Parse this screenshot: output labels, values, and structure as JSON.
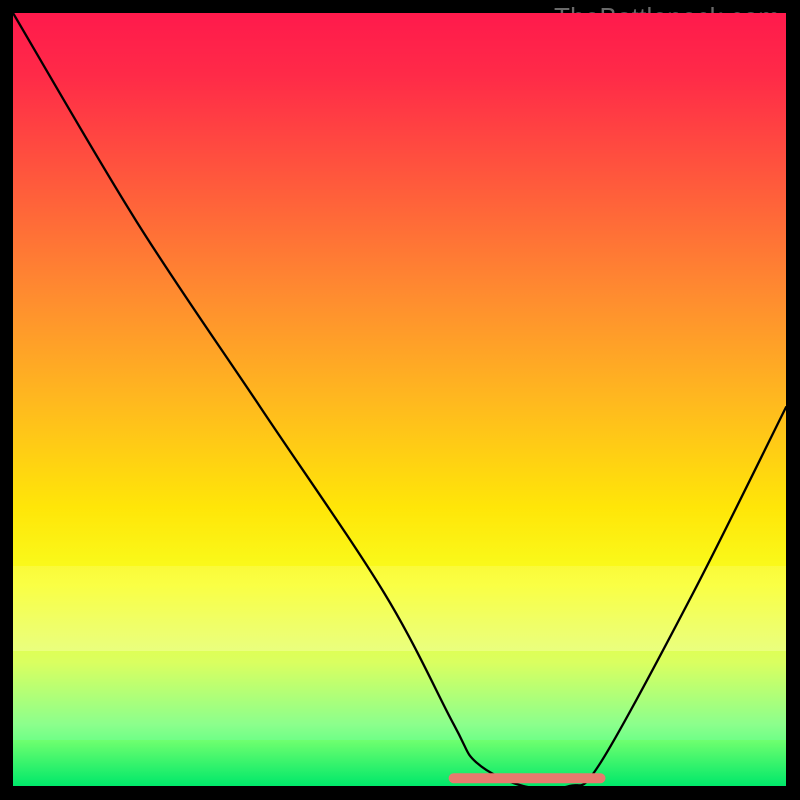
{
  "watermark": "TheBottleneck.com",
  "chart_data": {
    "type": "line",
    "title": "",
    "xlabel": "",
    "ylabel": "",
    "xlim": [
      0,
      100
    ],
    "ylim": [
      0,
      100
    ],
    "series": [
      {
        "name": "curve",
        "x": [
          0,
          16,
          32,
          48,
          57,
          60,
          66,
          72,
          76,
          88,
          100
        ],
        "values": [
          100,
          73,
          49,
          25,
          8,
          3,
          0,
          0,
          3,
          25,
          49
        ]
      }
    ],
    "marker": {
      "name": "salmon-segment",
      "x_range": [
        57,
        76
      ],
      "y": 1,
      "color": "#e87a6e"
    },
    "gradient_stops": [
      {
        "pos": 0,
        "color": "#ff1a4c"
      },
      {
        "pos": 22,
        "color": "#ff5a3c"
      },
      {
        "pos": 50,
        "color": "#ffb81f"
      },
      {
        "pos": 74,
        "color": "#f8ff20"
      },
      {
        "pos": 92,
        "color": "#8cff8c"
      },
      {
        "pos": 100,
        "color": "#1fff7a"
      }
    ]
  }
}
